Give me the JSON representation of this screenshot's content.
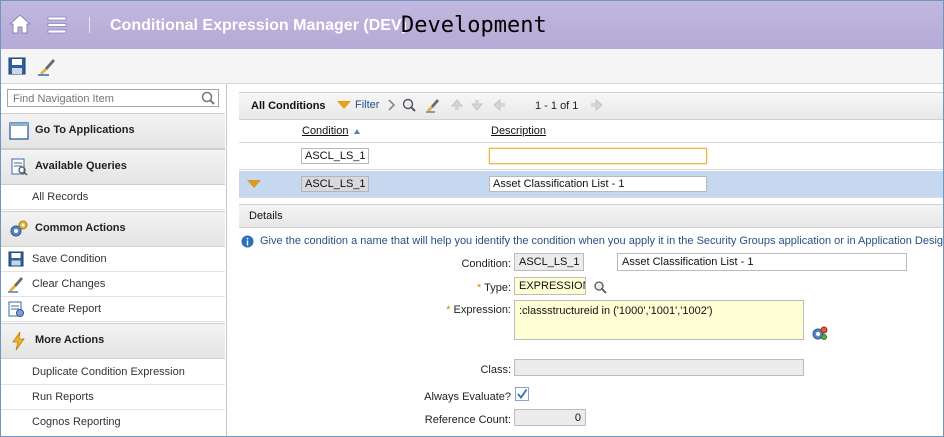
{
  "app": {
    "title": "Conditional Expression Manager (DEV)",
    "environment": "Development"
  },
  "toolbar": {
    "save_icon": "save-icon",
    "clear_icon": "clear-changes-icon"
  },
  "sidebar": {
    "search_placeholder": "Find Navigation Item",
    "go_to_applications": "Go To Applications",
    "available_queries": "Available Queries",
    "all_records": "All Records",
    "common_actions": "Common Actions",
    "save_condition": "Save Condition",
    "clear_changes": "Clear Changes",
    "create_report": "Create Report",
    "more_actions": "More Actions",
    "duplicate_condition": "Duplicate Condition Expression",
    "run_reports": "Run Reports",
    "cognos_reporting": "Cognos Reporting"
  },
  "list": {
    "title": "All Conditions",
    "filter_label": "Filter",
    "page_count": "1 - 1 of 1",
    "columns": {
      "condition": "Condition",
      "description": "Description"
    },
    "filter_row": {
      "condition": "ASCL_LS_1",
      "description": ""
    },
    "rows": [
      {
        "condition": "ASCL_LS_1",
        "description": "Asset Classification List - 1"
      }
    ]
  },
  "details": {
    "header": "Details",
    "info": "Give the condition a name that will help you identify the condition when you apply it in the Security Groups application or in Application Designer. If",
    "condition_label": "Condition:",
    "condition_value": "ASCL_LS_1",
    "description_value": "Asset Classification List - 1",
    "type_label": "Type:",
    "type_value": "EXPRESSION",
    "expression_label": "Expression:",
    "expression_value": ":classstructureid in ('1000','1001','1002')",
    "class_label": "Class:",
    "class_value": "",
    "always_evaluate_label": "Always Evaluate?",
    "always_evaluate": true,
    "reference_count_label": "Reference Count:",
    "reference_count_value": "0"
  },
  "colors": {
    "title_bar": "#b5a9d6",
    "selected_row": "#c5d8ef",
    "accent_orange": "#e6a21a",
    "info_text": "#2a4f86"
  }
}
